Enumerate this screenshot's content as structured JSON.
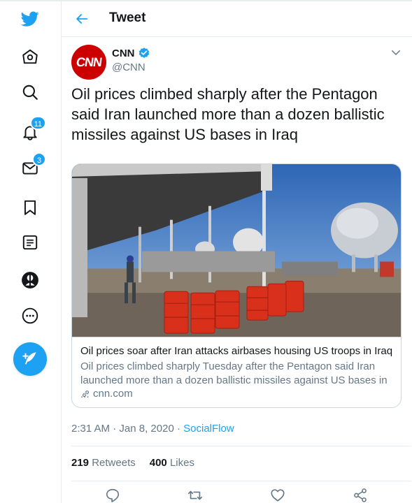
{
  "header": {
    "title": "Tweet"
  },
  "sidebar": {
    "icons": [
      "twitter-logo",
      "home-icon",
      "explore-icon",
      "notifications-icon",
      "messages-icon",
      "bookmarks-icon",
      "lists-icon",
      "profile-icon",
      "more-icon",
      "compose-icon"
    ],
    "notifications_badge": "11",
    "messages_badge": "3"
  },
  "tweet": {
    "author_name": "CNN",
    "author_handle": "@CNN",
    "avatar_text": "CNN",
    "verified": true,
    "text": "Oil prices climbed sharply after the Pentagon said Iran launched more than a dozen ballistic missiles against US bases in Iraq",
    "card": {
      "title": "Oil prices soar after Iran attacks airbases housing US troops in Iraq",
      "description": "Oil prices climbed sharply Tuesday after the Pentagon said Iran launched more than a dozen ballistic missiles against US bases in ...",
      "domain": "cnn.com"
    },
    "time": "2:31 AM",
    "date": "Jan 8, 2020",
    "meta_separator": "·",
    "source": "SocialFlow",
    "retweets_count": "219",
    "retweets_label": "Retweets",
    "likes_count": "400",
    "likes_label": "Likes"
  },
  "colors": {
    "accent": "#1da1f2",
    "cnn_red": "#cc0000",
    "text_primary": "#14171a",
    "text_secondary": "#657786",
    "border": "#e6ecf0"
  }
}
